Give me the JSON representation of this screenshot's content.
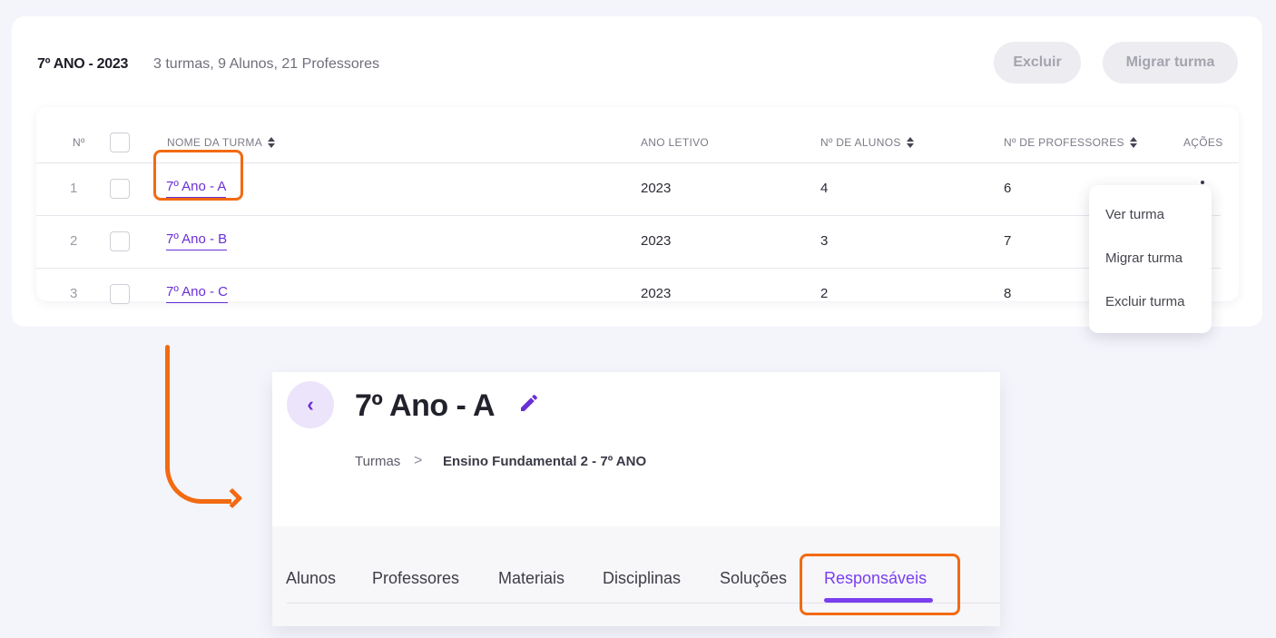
{
  "list": {
    "title": "7º ANO - 2023",
    "subtitle": "3 turmas, 9 Alunos, 21 Professores",
    "btn_excluir": "Excluir",
    "btn_migrar": "Migrar turma",
    "headers": {
      "num": "Nº",
      "nome": "NOME DA TURMA",
      "ano": "ANO LETIVO",
      "alunos": "Nº DE ALUNOS",
      "professores": "Nº DE PROFESSORES",
      "acoes": "AÇÕES"
    },
    "rows": [
      {
        "num": "1",
        "nome": "7º Ano - A",
        "ano": "2023",
        "alunos": "4",
        "professores": "6"
      },
      {
        "num": "2",
        "nome": "7º Ano - B",
        "ano": "2023",
        "alunos": "3",
        "professores": "7"
      },
      {
        "num": "3",
        "nome": "7º Ano - C",
        "ano": "2023",
        "alunos": "2",
        "professores": "8"
      }
    ],
    "menu": [
      "Ver turma",
      "Migrar turma",
      "Excluir turma"
    ]
  },
  "detail": {
    "title": "7º Ano - A",
    "breadcrumb_root": "Turmas",
    "breadcrumb_sep": ">",
    "breadcrumb_current": "Ensino Fundamental 2 - 7º ANO",
    "back_glyph": "‹",
    "tabs": [
      "Alunos",
      "Professores",
      "Materiais",
      "Disciplinas",
      "Soluções",
      "Responsáveis"
    ]
  },
  "colors": {
    "accent": "#6a2fd6",
    "highlight": "#f26a12"
  },
  "icons": [
    "sort-icon",
    "kebab-menu-icon",
    "back-chevron-icon",
    "pencil-icon",
    "arrow-icon"
  ]
}
